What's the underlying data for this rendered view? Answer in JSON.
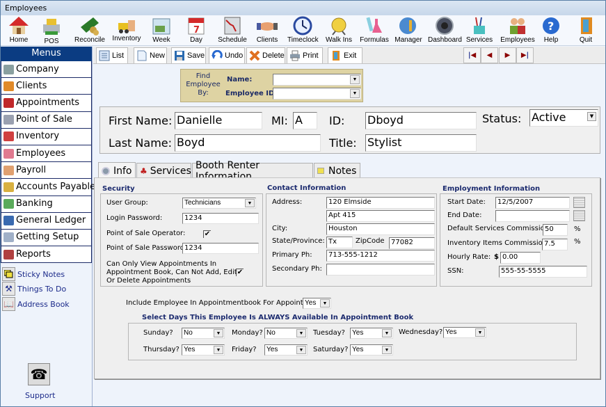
{
  "window": {
    "title": "Employees"
  },
  "toolbar": [
    {
      "label": "Home",
      "icon": "home-icon"
    },
    {
      "label": "POS",
      "icon": "cash-register-icon"
    },
    {
      "label": "Reconcile",
      "icon": "money-icon"
    },
    {
      "label": "Inventory",
      "icon": "forklift-icon"
    },
    {
      "label": "Week",
      "icon": "week-calendar-icon"
    },
    {
      "label": "Day",
      "icon": "day-calendar-icon",
      "day_number": "7"
    },
    {
      "label": "Schedule",
      "icon": "schedule-grid-icon"
    },
    {
      "label": "Clients",
      "icon": "handshake-icon"
    },
    {
      "label": "Timeclock",
      "icon": "clock-icon"
    },
    {
      "label": "Walk Ins",
      "icon": "walking-clock-icon"
    },
    {
      "label": "Formulas",
      "icon": "flask-icon"
    },
    {
      "label": "Manager",
      "icon": "globe-key-icon"
    },
    {
      "label": "Dashboard",
      "icon": "gauge-icon"
    },
    {
      "label": "Services",
      "icon": "tools-cup-icon"
    },
    {
      "label": "Employees",
      "icon": "people-icon"
    },
    {
      "label": "Help",
      "icon": "help-icon"
    },
    {
      "label": "Quit",
      "icon": "door-exit-icon"
    }
  ],
  "sidebar": {
    "header": "Menus",
    "items": [
      {
        "label": "Company",
        "color": "#8aa0a0"
      },
      {
        "label": "Clients",
        "color": "#e08a2a"
      },
      {
        "label": "Appointments",
        "color": "#c0282a"
      },
      {
        "label": "Point of Sale",
        "color": "#9aa0b0"
      },
      {
        "label": "Inventory",
        "color": "#d04040"
      },
      {
        "label": "Employees",
        "color": "#e07a90"
      },
      {
        "label": "Payroll",
        "color": "#e0a070"
      },
      {
        "label": "Accounts Payable",
        "color": "#d8b040"
      },
      {
        "label": "Banking",
        "color": "#5aaa5a"
      },
      {
        "label": "General Ledger",
        "color": "#3a6ab0"
      },
      {
        "label": "Getting Setup",
        "color": "#a0b0c8"
      },
      {
        "label": "Reports",
        "color": "#b04040"
      }
    ],
    "quicklinks": [
      {
        "label": "Sticky Notes",
        "icon": "sticky-note-icon"
      },
      {
        "label": "Things To Do",
        "icon": "hammer-icon"
      },
      {
        "label": "Address Book",
        "icon": "book-icon"
      }
    ],
    "support_label": "Support"
  },
  "actions": [
    {
      "label": "List",
      "icon": "list-icon"
    },
    {
      "label": "New",
      "icon": "new-document-icon"
    },
    {
      "label": "Save",
      "icon": "floppy-icon"
    },
    {
      "label": "Undo",
      "icon": "undo-icon"
    },
    {
      "label": "Delete",
      "icon": "delete-x-icon"
    },
    {
      "label": "Print",
      "icon": "printer-icon"
    },
    {
      "label": "Exit",
      "icon": "door-icon"
    }
  ],
  "nav": {
    "first": "|◄",
    "prev": "◄",
    "next": "►",
    "last": "►|"
  },
  "find": {
    "label": "Find Employee By:",
    "name_label": "Name:",
    "name_value": "",
    "id_label": "Employee ID:",
    "id_value": ""
  },
  "employee": {
    "first_name_label": "First Name:",
    "first_name": "Danielle",
    "mi_label": "MI:",
    "mi": "A",
    "id_label": "ID:",
    "id": "Dboyd",
    "status_label": "Status:",
    "status": "Active",
    "last_name_label": "Last Name:",
    "last_name": "Boyd",
    "title_label": "Title:",
    "title": "Stylist"
  },
  "tabs": [
    {
      "label": "Info",
      "active": true
    },
    {
      "label": "Services",
      "active": false
    },
    {
      "label": "Booth Renter Information",
      "active": false
    },
    {
      "label": "Notes",
      "active": false
    }
  ],
  "security": {
    "title": "Security",
    "user_group_label": "User Group:",
    "user_group": "Technicians",
    "login_password_label": "Login Password:",
    "login_password": "1234",
    "pos_operator_label": "Point of Sale Operator:",
    "pos_operator_checked": true,
    "pos_password_label": "Point of  Sale Password:",
    "pos_password": "1234",
    "view_only_label_1": "Can Only View Appointments In",
    "view_only_label_2": "Appointment Book, Can Not Add, Edit",
    "view_only_label_3": "Or Delete Appointments",
    "view_only_checked": true
  },
  "contact": {
    "title": "Contact Information",
    "address_label": "Address:",
    "address1": "120 Elmside",
    "address2": "Apt 415",
    "city_label": "City:",
    "city": "Houston",
    "state_label": "State/Province:",
    "state": "Tx",
    "zip_label": "ZipCode",
    "zip": "77082",
    "primary_label": "Primary Ph:",
    "primary": "713-555-1212",
    "secondary_label": "Secondary Ph:",
    "secondary": ""
  },
  "employment": {
    "title": "Employment Information",
    "start_label": "Start Date:",
    "start": "12/5/2007",
    "end_label": "End Date:",
    "end": "",
    "svc_comm_label": "Default Services Commission:",
    "svc_comm": "50",
    "inv_comm_label": "Inventory Items Commission:",
    "inv_comm": "7.5",
    "percent": "%",
    "hourly_label": "Hourly Rate:",
    "currency": "$",
    "hourly": "0.00",
    "ssn_label": "SSN:",
    "ssn": "555-55-5555"
  },
  "appointments": {
    "include_label": "Include Employee In Appointmentbook For Appointments?",
    "include_value": "Yes",
    "days_title": "Select Days This Employee Is ALWAYS Available In Appointment Book",
    "days": [
      {
        "label": "Sunday?",
        "value": "No"
      },
      {
        "label": "Monday?",
        "value": "No"
      },
      {
        "label": "Tuesday?",
        "value": "Yes"
      },
      {
        "label": "Wednesday?",
        "value": "Yes"
      },
      {
        "label": "Thursday?",
        "value": "Yes"
      },
      {
        "label": "Friday?",
        "value": "Yes"
      },
      {
        "label": "Saturday?",
        "value": "Yes"
      }
    ]
  }
}
